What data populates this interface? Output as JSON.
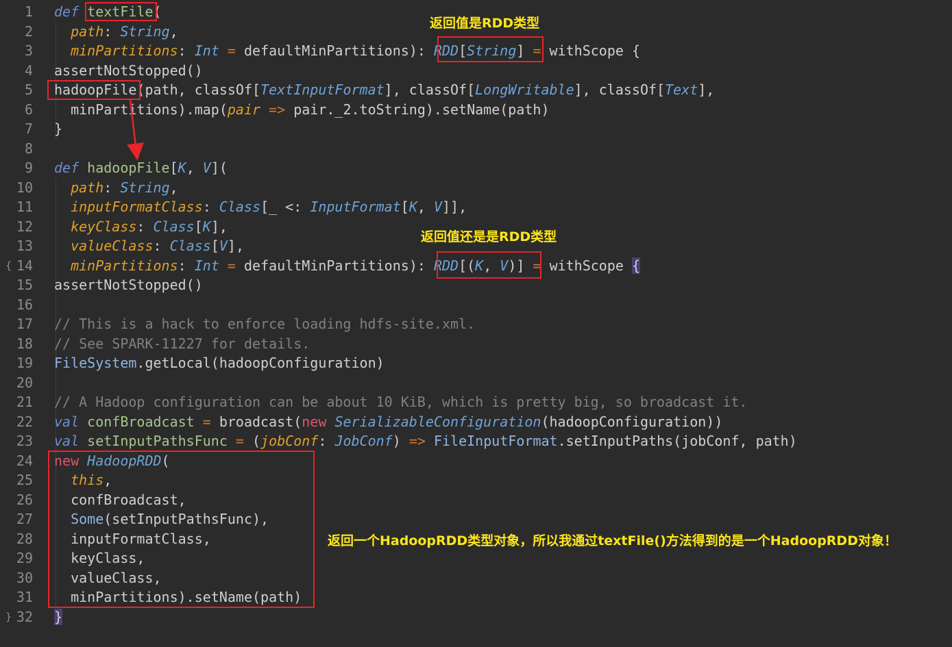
{
  "editor": {
    "line_numbers": [
      "1",
      "2",
      "3",
      "4",
      "5",
      "6",
      "7",
      "8",
      "9",
      "10",
      "11",
      "12",
      "13",
      "14",
      "15",
      "16",
      "17",
      "18",
      "19",
      "20",
      "21",
      "22",
      "23",
      "24",
      "25",
      "26",
      "27",
      "28",
      "29",
      "30",
      "31",
      "32"
    ],
    "fold_markers": [
      {
        "line": 14,
        "glyph": "{"
      },
      {
        "line": 32,
        "glyph": "}"
      }
    ],
    "lines": [
      [
        [
          "def ",
          "def"
        ],
        [
          "textFile",
          "fn"
        ],
        [
          "(",
          "plain"
        ]
      ],
      [
        [
          "  ",
          "plain"
        ],
        [
          "path",
          "param"
        ],
        [
          ": ",
          "plain"
        ],
        [
          "String",
          "type"
        ],
        [
          ",",
          "plain"
        ]
      ],
      [
        [
          "  ",
          "plain"
        ],
        [
          "minPartitions",
          "param"
        ],
        [
          ": ",
          "plain"
        ],
        [
          "Int",
          "type"
        ],
        [
          " = ",
          "op"
        ],
        [
          "defaultMinPartitions",
          "plain"
        ],
        [
          "): ",
          "plain"
        ],
        [
          "RDD",
          "type"
        ],
        [
          "[",
          "plain"
        ],
        [
          "String",
          "type"
        ],
        [
          "]",
          "plain"
        ],
        [
          " = ",
          "op"
        ],
        [
          "withScope {",
          "plain"
        ]
      ],
      [
        [
          "assertNotStopped()",
          "plain"
        ]
      ],
      [
        [
          "hadoopFile",
          "plain"
        ],
        [
          "(path, classOf[",
          "plain"
        ],
        [
          "TextInputFormat",
          "type"
        ],
        [
          "], classOf[",
          "plain"
        ],
        [
          "LongWritable",
          "type"
        ],
        [
          "], classOf[",
          "plain"
        ],
        [
          "Text",
          "type"
        ],
        [
          "],",
          "plain"
        ]
      ],
      [
        [
          "  minPartitions).map(",
          "plain"
        ],
        [
          "pair",
          "param"
        ],
        [
          " => ",
          "op"
        ],
        [
          "pair._2.toString).setName(path)",
          "plain"
        ]
      ],
      [
        [
          "}",
          "plain"
        ]
      ],
      [],
      [
        [
          "def ",
          "def"
        ],
        [
          "hadoopFile",
          "fn"
        ],
        [
          "[",
          "plain"
        ],
        [
          "K",
          "type"
        ],
        [
          ", ",
          "plain"
        ],
        [
          "V",
          "type"
        ],
        [
          "](",
          "plain"
        ]
      ],
      [
        [
          "  ",
          "plain"
        ],
        [
          "path",
          "param"
        ],
        [
          ": ",
          "plain"
        ],
        [
          "String",
          "type"
        ],
        [
          ",",
          "plain"
        ]
      ],
      [
        [
          "  ",
          "plain"
        ],
        [
          "inputFormatClass",
          "param"
        ],
        [
          ": ",
          "plain"
        ],
        [
          "Class",
          "type"
        ],
        [
          "[_ <: ",
          "plain"
        ],
        [
          "InputFormat",
          "type"
        ],
        [
          "[",
          "plain"
        ],
        [
          "K",
          "type"
        ],
        [
          ", ",
          "plain"
        ],
        [
          "V",
          "type"
        ],
        [
          "]],",
          "plain"
        ]
      ],
      [
        [
          "  ",
          "plain"
        ],
        [
          "keyClass",
          "param"
        ],
        [
          ": ",
          "plain"
        ],
        [
          "Class",
          "type"
        ],
        [
          "[",
          "plain"
        ],
        [
          "K",
          "type"
        ],
        [
          "],",
          "plain"
        ]
      ],
      [
        [
          "  ",
          "plain"
        ],
        [
          "valueClass",
          "param"
        ],
        [
          ": ",
          "plain"
        ],
        [
          "Class",
          "type"
        ],
        [
          "[",
          "plain"
        ],
        [
          "V",
          "type"
        ],
        [
          "],",
          "plain"
        ]
      ],
      [
        [
          "  ",
          "plain"
        ],
        [
          "minPartitions",
          "param"
        ],
        [
          ": ",
          "plain"
        ],
        [
          "Int",
          "type"
        ],
        [
          " = ",
          "op"
        ],
        [
          "defaultMinPartitions",
          "plain"
        ],
        [
          "): ",
          "plain"
        ],
        [
          "RDD",
          "type"
        ],
        [
          "[(",
          "plain"
        ],
        [
          "K",
          "type"
        ],
        [
          ", ",
          "plain"
        ],
        [
          "V",
          "type"
        ],
        [
          ")]",
          "plain"
        ],
        [
          " = ",
          "op"
        ],
        [
          "withScope ",
          "plain"
        ],
        [
          "{",
          "brace"
        ]
      ],
      [
        [
          "assertNotStopped()",
          "plain"
        ]
      ],
      [],
      [
        [
          "// This is a hack to enforce loading hdfs-site.xml.",
          "com"
        ]
      ],
      [
        [
          "// See SPARK-11227 for details.",
          "com"
        ]
      ],
      [
        [
          "FileSystem",
          "cls"
        ],
        [
          ".getLocal(hadoopConfiguration)",
          "plain"
        ]
      ],
      [],
      [
        [
          "// A Hadoop configuration can be about 10 KiB, which is pretty big, so broadcast it.",
          "com"
        ]
      ],
      [
        [
          "val ",
          "def"
        ],
        [
          "confBroadcast",
          "fn"
        ],
        [
          " = ",
          "op"
        ],
        [
          "broadcast(",
          "plain"
        ],
        [
          "new ",
          "new"
        ],
        [
          "SerializableConfiguration",
          "type"
        ],
        [
          "(hadoopConfiguration))",
          "plain"
        ]
      ],
      [
        [
          "val ",
          "def"
        ],
        [
          "setInputPathsFunc",
          "fn"
        ],
        [
          " = ",
          "op"
        ],
        [
          "(",
          "plain"
        ],
        [
          "jobConf",
          "param"
        ],
        [
          ": ",
          "plain"
        ],
        [
          "JobConf",
          "type"
        ],
        [
          ") ",
          "plain"
        ],
        [
          "=> ",
          "op"
        ],
        [
          "FileInputFormat",
          "cls"
        ],
        [
          ".setInputPaths(jobConf, path)",
          "plain"
        ]
      ],
      [
        [
          "new ",
          "new"
        ],
        [
          "HadoopRDD",
          "type"
        ],
        [
          "(",
          "plain"
        ]
      ],
      [
        [
          "  ",
          "plain"
        ],
        [
          "this",
          "this"
        ],
        [
          ",",
          "plain"
        ]
      ],
      [
        [
          "  confBroadcast,",
          "plain"
        ]
      ],
      [
        [
          "  ",
          "plain"
        ],
        [
          "Some",
          "cls"
        ],
        [
          "(setInputPathsFunc),",
          "plain"
        ]
      ],
      [
        [
          "  inputFormatClass,",
          "plain"
        ]
      ],
      [
        [
          "  keyClass,",
          "plain"
        ]
      ],
      [
        [
          "  valueClass,",
          "plain"
        ]
      ],
      [
        [
          "  minPartitions).setName(path)",
          "plain"
        ]
      ],
      [
        [
          "}",
          "brace"
        ]
      ]
    ]
  },
  "annotations": {
    "note1": "返回值是RDD类型",
    "note2": "返回值还是是RDD类型",
    "note3": "返回一个HadoopRDD类型对象，所以我通过textFile()方法得到的是一个HadoopRDD对象！"
  },
  "colors": {
    "background": "#2b2b2b",
    "annotation_box": "#e8252a",
    "annotation_text": "#ffe619",
    "keyword": "#6b8ed6",
    "parameter": "#e0a02a",
    "type": "#6ea3d8",
    "comment": "#7f8184"
  }
}
